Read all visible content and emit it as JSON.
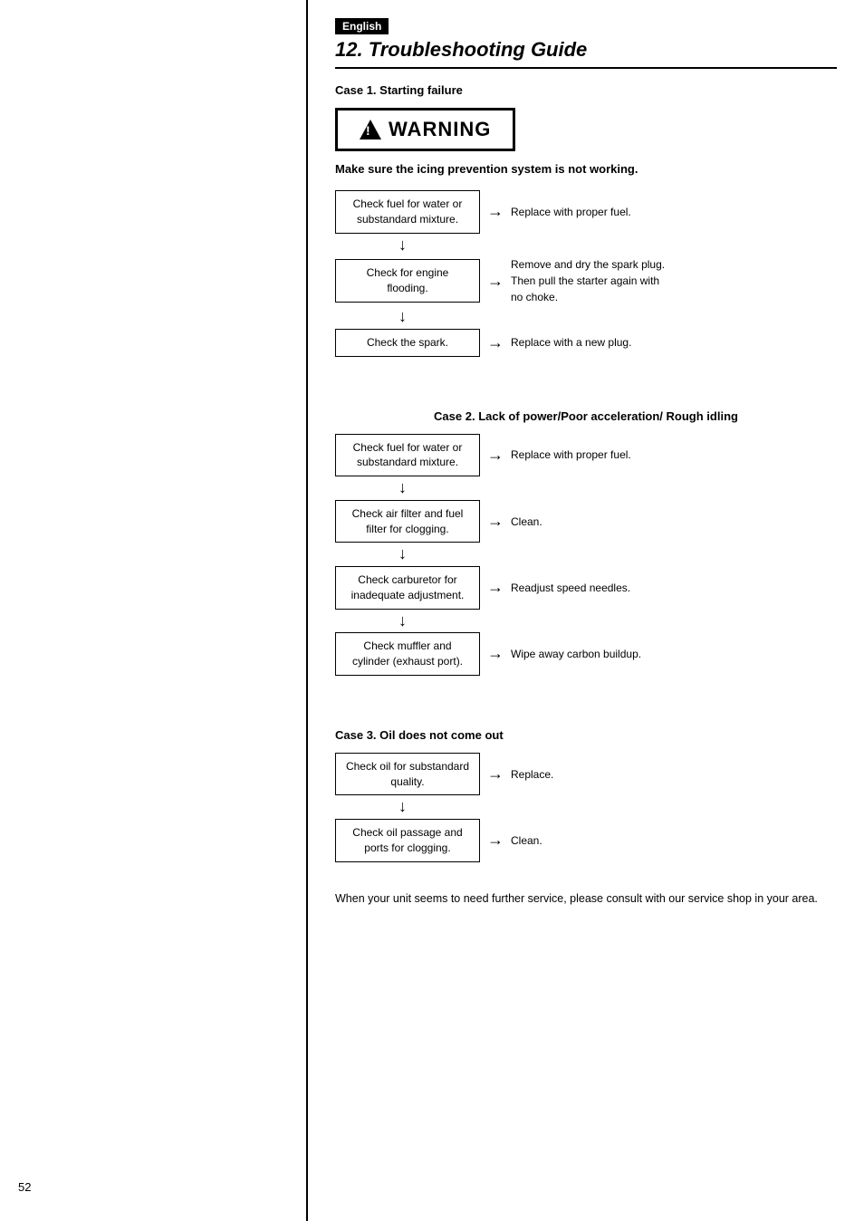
{
  "page": {
    "number": "52",
    "language_badge": "English",
    "section_title": "12. Troubleshooting Guide"
  },
  "warning": {
    "label": "WARNING",
    "note": "Make sure the icing prevention system is not working."
  },
  "case1": {
    "title": "Case 1. Starting failure",
    "steps": [
      {
        "check": "Check fuel for water or substandard mixture.",
        "result": "Replace with proper fuel."
      },
      {
        "check": "Check for engine flooding.",
        "result": "Remove and dry the spark plug.\nThen pull the starter again with no choke."
      },
      {
        "check": "Check the spark.",
        "result": "Replace with a new plug."
      }
    ]
  },
  "case2": {
    "title": "Case 2. Lack of power/Poor acceleration/ Rough idling",
    "steps": [
      {
        "check": "Check fuel for water or substandard mixture.",
        "result": "Replace with proper fuel."
      },
      {
        "check": "Check air filter and fuel filter for clogging.",
        "result": "Clean."
      },
      {
        "check": "Check carburetor for inadequate adjustment.",
        "result": "Readjust speed needles."
      },
      {
        "check": "Check muffler and cylinder (exhaust port).",
        "result": "Wipe away carbon buildup."
      }
    ]
  },
  "case3": {
    "title": "Case 3. Oil does not come out",
    "steps": [
      {
        "check": "Check oil for substandard quality.",
        "result": "Replace."
      },
      {
        "check": "Check oil passage and ports for clogging.",
        "result": "Clean."
      }
    ]
  },
  "footer": {
    "note": "When your unit seems to need further service, please consult with our service shop in your area."
  }
}
